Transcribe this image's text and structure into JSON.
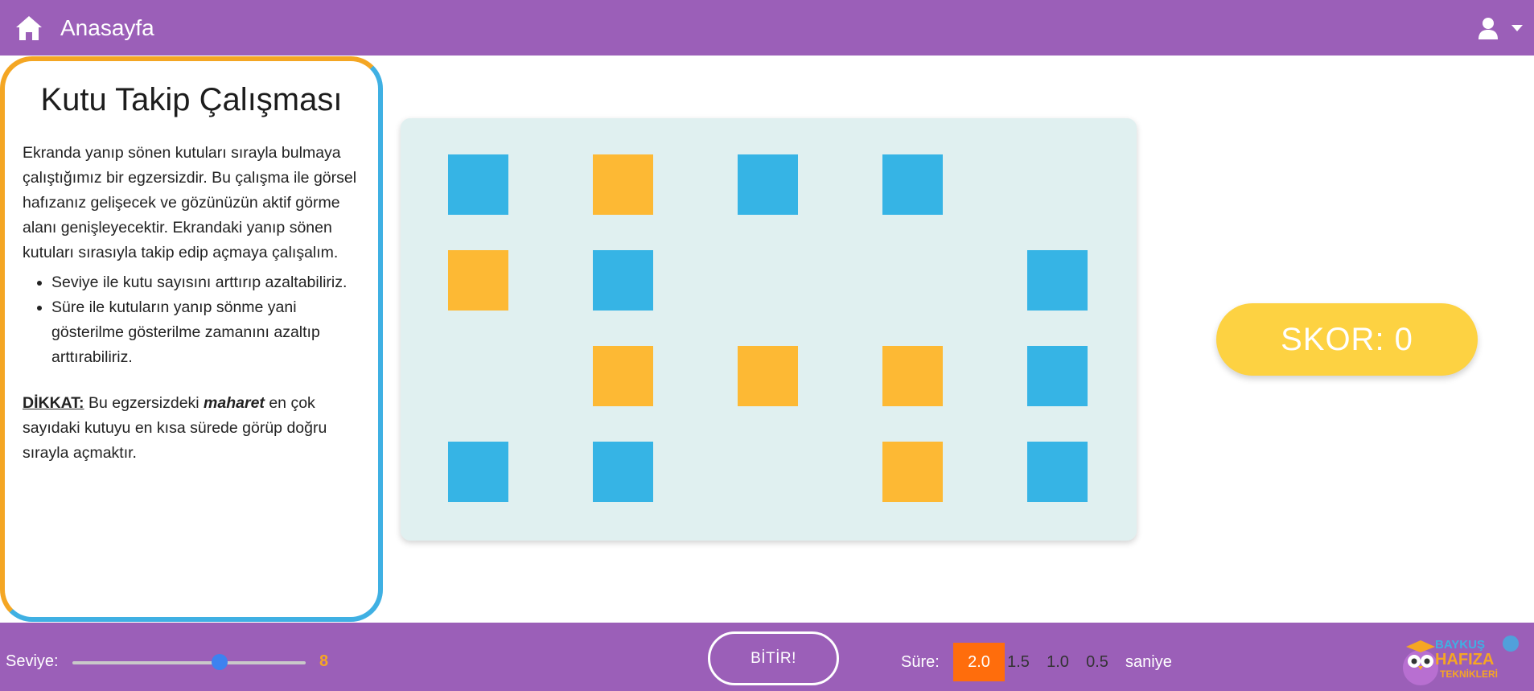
{
  "nav": {
    "title": "Anasayfa",
    "home_icon": "home-icon",
    "user_icon": "user-icon"
  },
  "info": {
    "title": "Kutu Takip Çalışması",
    "description": "Ekranda yanıp sönen kutuları sırayla bulmaya çalıştığımız bir egzersizdir. Bu çalışma ile görsel hafızanız gelişecek ve gözünüzün aktif görme alanı genişleyecektir. Ekrandaki yanıp sönen kutuları sırasıyla takip edip açmaya çalışalım.",
    "bullets": [
      "Seviye ile kutu sayısını arttırıp azaltabiliriz.",
      "Süre ile kutuların yanıp sönme yani gösterilme gösterilme zamanını azaltıp arttırabiliriz."
    ],
    "warning_label": "DİKKAT:",
    "warning_before": " Bu egzersizdeki ",
    "warning_emph": "maharet",
    "warning_after": " en çok sayıdaki kutuyu en kısa sürede görüp doğru sırayla açmaktır."
  },
  "board": {
    "colors": {
      "blue": "#36b4e5",
      "orange": "#fdb934",
      "board_bg": "#e0f0f0"
    },
    "grid": [
      [
        "blue",
        "orange",
        "blue",
        "blue",
        null
      ],
      [
        "orange",
        "blue",
        null,
        null,
        "blue"
      ],
      [
        null,
        "orange",
        "orange",
        "orange",
        "blue"
      ],
      [
        "blue",
        "blue",
        null,
        "orange",
        "blue"
      ]
    ]
  },
  "score": {
    "text": "SKOR: 0"
  },
  "footer": {
    "level_label": "Seviye:",
    "level_value": "8",
    "level_fraction": 0.63,
    "finish_label": "BİTİR!",
    "time_label": "Süre:",
    "time_options": [
      "2.0",
      "1.5",
      "1.0",
      "0.5"
    ],
    "time_selected": "2.0",
    "time_unit": "saniye",
    "logo_text_top": "BAYKUŞ",
    "logo_text_mid": "HAFIZA",
    "logo_text_bottom": "TEKNİKLERİ"
  },
  "theme": {
    "purple": "#9b5fb8",
    "accent_orange": "#ff6d0c",
    "score_yellow": "#fdd242",
    "slider_blue": "#3d82f0"
  }
}
